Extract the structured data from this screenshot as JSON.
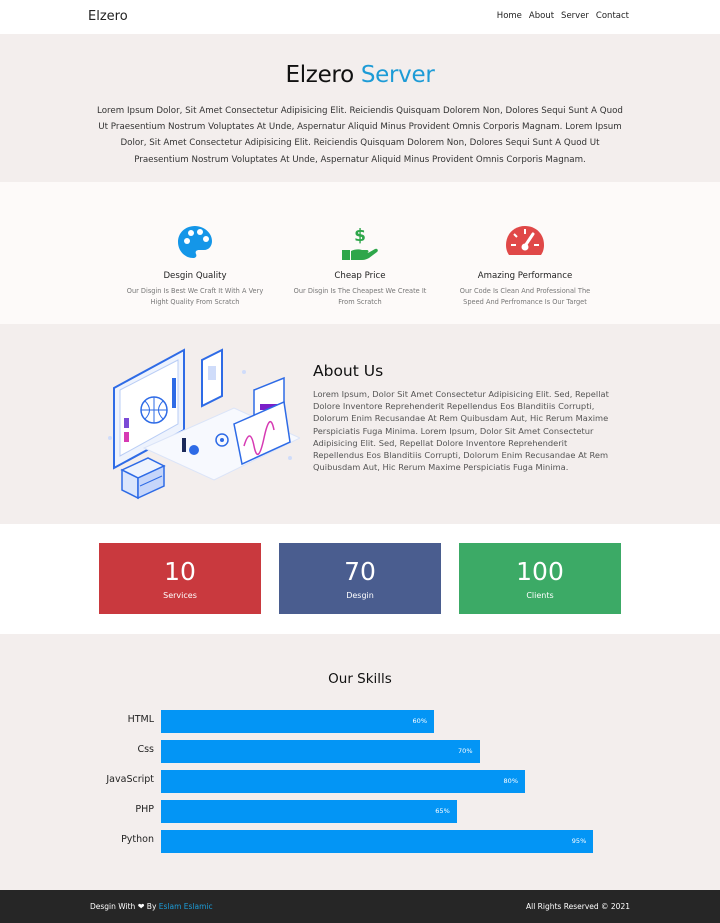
{
  "header": {
    "logo": "Elzero",
    "nav": [
      "Home",
      "About",
      "Server",
      "Contact"
    ]
  },
  "hero": {
    "title_main": "Elzero",
    "title_accent": "Server",
    "text": "Lorem Ipsum Dolor, Sit Amet Consectetur Adipisicing Elit. Reiciendis Quisquam Dolorem Non, Dolores Sequi Sunt A Quod Ut Praesentium Nostrum Voluptates At Unde, Aspernatur Aliquid Minus Provident Omnis Corporis Magnam. Lorem Ipsum Dolor, Sit Amet Consectetur Adipisicing Elit. Reiciendis Quisquam Dolorem Non, Dolores Sequi Sunt A Quod Ut Praesentium Nostrum Voluptates At Unde, Aspernatur Aliquid Minus Provident Omnis Corporis Magnam."
  },
  "features": [
    {
      "icon": "palette-icon",
      "title": "Desgin Quality",
      "text": "Our Disgin Is Best We Craft It With A Very Hight Quality From Scratch"
    },
    {
      "icon": "hand-dollar-icon",
      "title": "Cheap Price",
      "text": "Our Disgin Is The Cheapest We Create It From Scratch"
    },
    {
      "icon": "speedometer-icon",
      "title": "Amazing Performance",
      "text": "Our Code Is Clean And Professional The Speed And Perfromance Is Our Target"
    }
  ],
  "about": {
    "title": "About Us",
    "text": "Lorem Ipsum, Dolor Sit Amet Consectetur Adipisicing Elit. Sed, Repellat Dolore Inventore Reprehenderit Repellendus Eos Blanditiis Corrupti, Dolorum Enim Recusandae At Rem Quibusdam Aut, Hic Rerum Maxime Perspiciatis Fuga Minima. Lorem Ipsum, Dolor Sit Amet Consectetur Adipisicing Elit. Sed, Repellat Dolore Inventore Reprehenderit Repellendus Eos Blanditiis Corrupti, Dolorum Enim Recusandae At Rem Quibusdam Aut, Hic Rerum Maxime Perspiciatis Fuga Minima."
  },
  "stats": [
    {
      "number": "10",
      "label": "Services",
      "color": "#c9393e"
    },
    {
      "number": "70",
      "label": "Desgin",
      "color": "#4a5d8f"
    },
    {
      "number": "100",
      "label": "Clients",
      "color": "#3caa66"
    }
  ],
  "skills": {
    "title": "Our Skills",
    "bar_color": "#0395f5",
    "items": [
      {
        "name": "HTML",
        "percent": 60,
        "label": "60%"
      },
      {
        "name": "Css",
        "percent": 70,
        "label": "70%"
      },
      {
        "name": "JavaScript",
        "percent": 80,
        "label": "80%"
      },
      {
        "name": "PHP",
        "percent": 65,
        "label": "65%"
      },
      {
        "name": "Python",
        "percent": 95,
        "label": "95%"
      }
    ]
  },
  "footer": {
    "left_prefix": "Desgin With",
    "left_by": "By",
    "author": "Eslam Eslamic",
    "right": "All Rights Reserved © 2021"
  }
}
